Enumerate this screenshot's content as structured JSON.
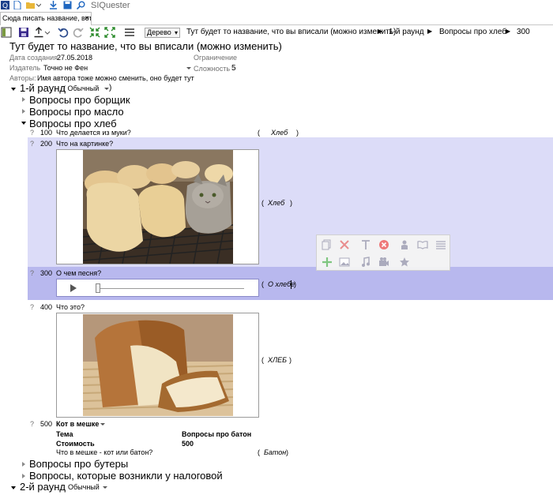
{
  "window": {
    "app_title": "SIQuester"
  },
  "tabs": [
    {
      "label": "Сюда писать название, вот",
      "close": "×"
    }
  ],
  "toolbar": {
    "view_mode": "Дерево",
    "breadcrumbs": [
      "Тут будет то название, что вы вписали (можно изменить)",
      "1-й раунд",
      "Вопросы про хлеб",
      "300"
    ]
  },
  "package": {
    "title": "Тут будет то название, что вы вписали (можно изменить)",
    "created_label": "Дата создания",
    "created_value": "27.05.2018",
    "publisher_label": "Издатель",
    "publisher_value": "Точно не Фен",
    "restriction_label": "Ограничение",
    "difficulty_label": "Сложность",
    "difficulty_value": "5",
    "authors_label": "Авторы:",
    "authors_value": "Имя автора тоже можно сменить, оно будет тут"
  },
  "rounds": [
    {
      "name": "1-й раунд",
      "type": "( Обычный",
      "type_close": ")"
    },
    {
      "name": "2-й раунд",
      "type": "Обычный"
    }
  ],
  "themes": [
    "Вопросы про борщик",
    "Вопросы про масло",
    "Вопросы про хлеб",
    "Вопросы про бутеры",
    "Вопросы, которые возникли у налоговой"
  ],
  "questions": [
    {
      "mark": "?",
      "price": "100",
      "text": "Что делается из муки?",
      "answer": "Хлеб",
      "open": "(",
      "close": ")"
    },
    {
      "mark": "?",
      "price": "200",
      "text": "Что на картинке?",
      "answer": "Хлеб",
      "open": "(",
      "close": ")"
    },
    {
      "mark": "?",
      "price": "300",
      "text": "О чем песня?",
      "answer": "О хлебе",
      "open": "(",
      "close": ")"
    },
    {
      "mark": "?",
      "price": "400",
      "text": "Что это?",
      "answer": "ХЛЕБ",
      "open": "(",
      "close": ")"
    },
    {
      "mark": "?",
      "price": "500",
      "text": "Кот в мешке",
      "answer": "Батон",
      "open": "(",
      "close": ")",
      "theme_label": "Тема",
      "theme_value": "Вопросы про батон",
      "cost_label": "Стоимость",
      "cost_value": "500",
      "sub_text": "Что в мешке - кот или батон?"
    }
  ],
  "colors": {
    "selected_row": "#dcdcf8",
    "active_row": "#b8b8ee",
    "accent": "#1e66c0"
  }
}
